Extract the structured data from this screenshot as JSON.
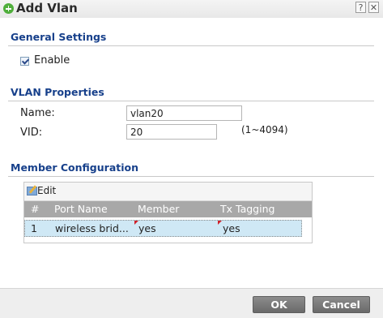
{
  "dialog": {
    "title": "Add Vlan",
    "help_icon": "help-icon",
    "close_icon": "close-icon"
  },
  "general": {
    "heading": "General Settings",
    "enable_label": "Enable",
    "enable_checked": true
  },
  "vlan": {
    "heading": "VLAN Properties",
    "name_label": "Name:",
    "name_value": "vlan20",
    "vid_label": "VID:",
    "vid_value": "20",
    "vid_hint": "(1~4094)"
  },
  "member": {
    "heading": "Member Configuration",
    "edit_label": "Edit",
    "columns": [
      "#",
      "Port Name",
      "Member",
      "Tx Tagging"
    ],
    "rows": [
      {
        "index": "1",
        "port_name": "wireless brid...",
        "member": "yes",
        "tx_tagging": "yes"
      }
    ]
  },
  "footer": {
    "ok_label": "OK",
    "cancel_label": "Cancel"
  },
  "colors": {
    "section_heading": "#17408b",
    "header_bg": "#a8a8a8",
    "selected_row": "#cfe8f5",
    "button_bg": "#7a7a7a",
    "add_icon": "#4fae3b"
  }
}
